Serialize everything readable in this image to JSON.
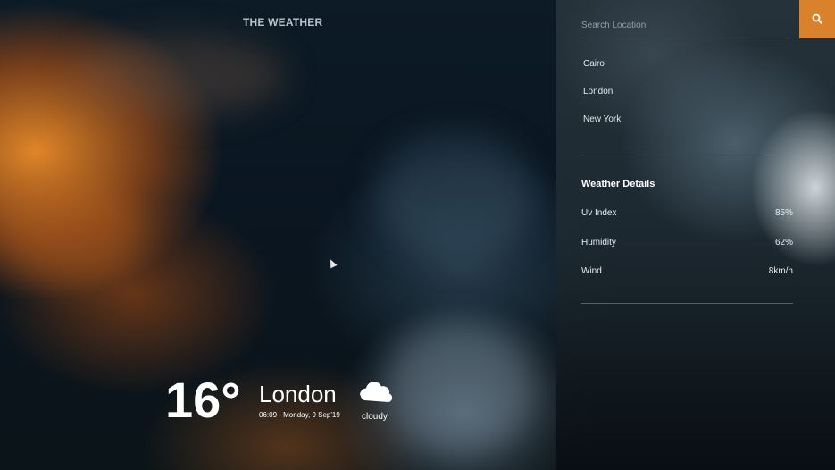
{
  "header": {
    "brand": "THE WEATHER"
  },
  "current": {
    "temperature": "16°",
    "city": "London",
    "datetime": "06:09 - Monday, 9 Sep'19",
    "condition": "cloudy",
    "condition_icon": "cloud-icon"
  },
  "search": {
    "placeholder": "Search Location",
    "button_icon": "search-icon",
    "button_color": "#d9822b"
  },
  "cities": [
    "Cairo",
    "London",
    "New York"
  ],
  "details": {
    "title": "Weather Details",
    "items": [
      {
        "label": "Uv Index",
        "value": "85%"
      },
      {
        "label": "Humidity",
        "value": "62%"
      },
      {
        "label": "Wind",
        "value": "8km/h"
      }
    ]
  }
}
